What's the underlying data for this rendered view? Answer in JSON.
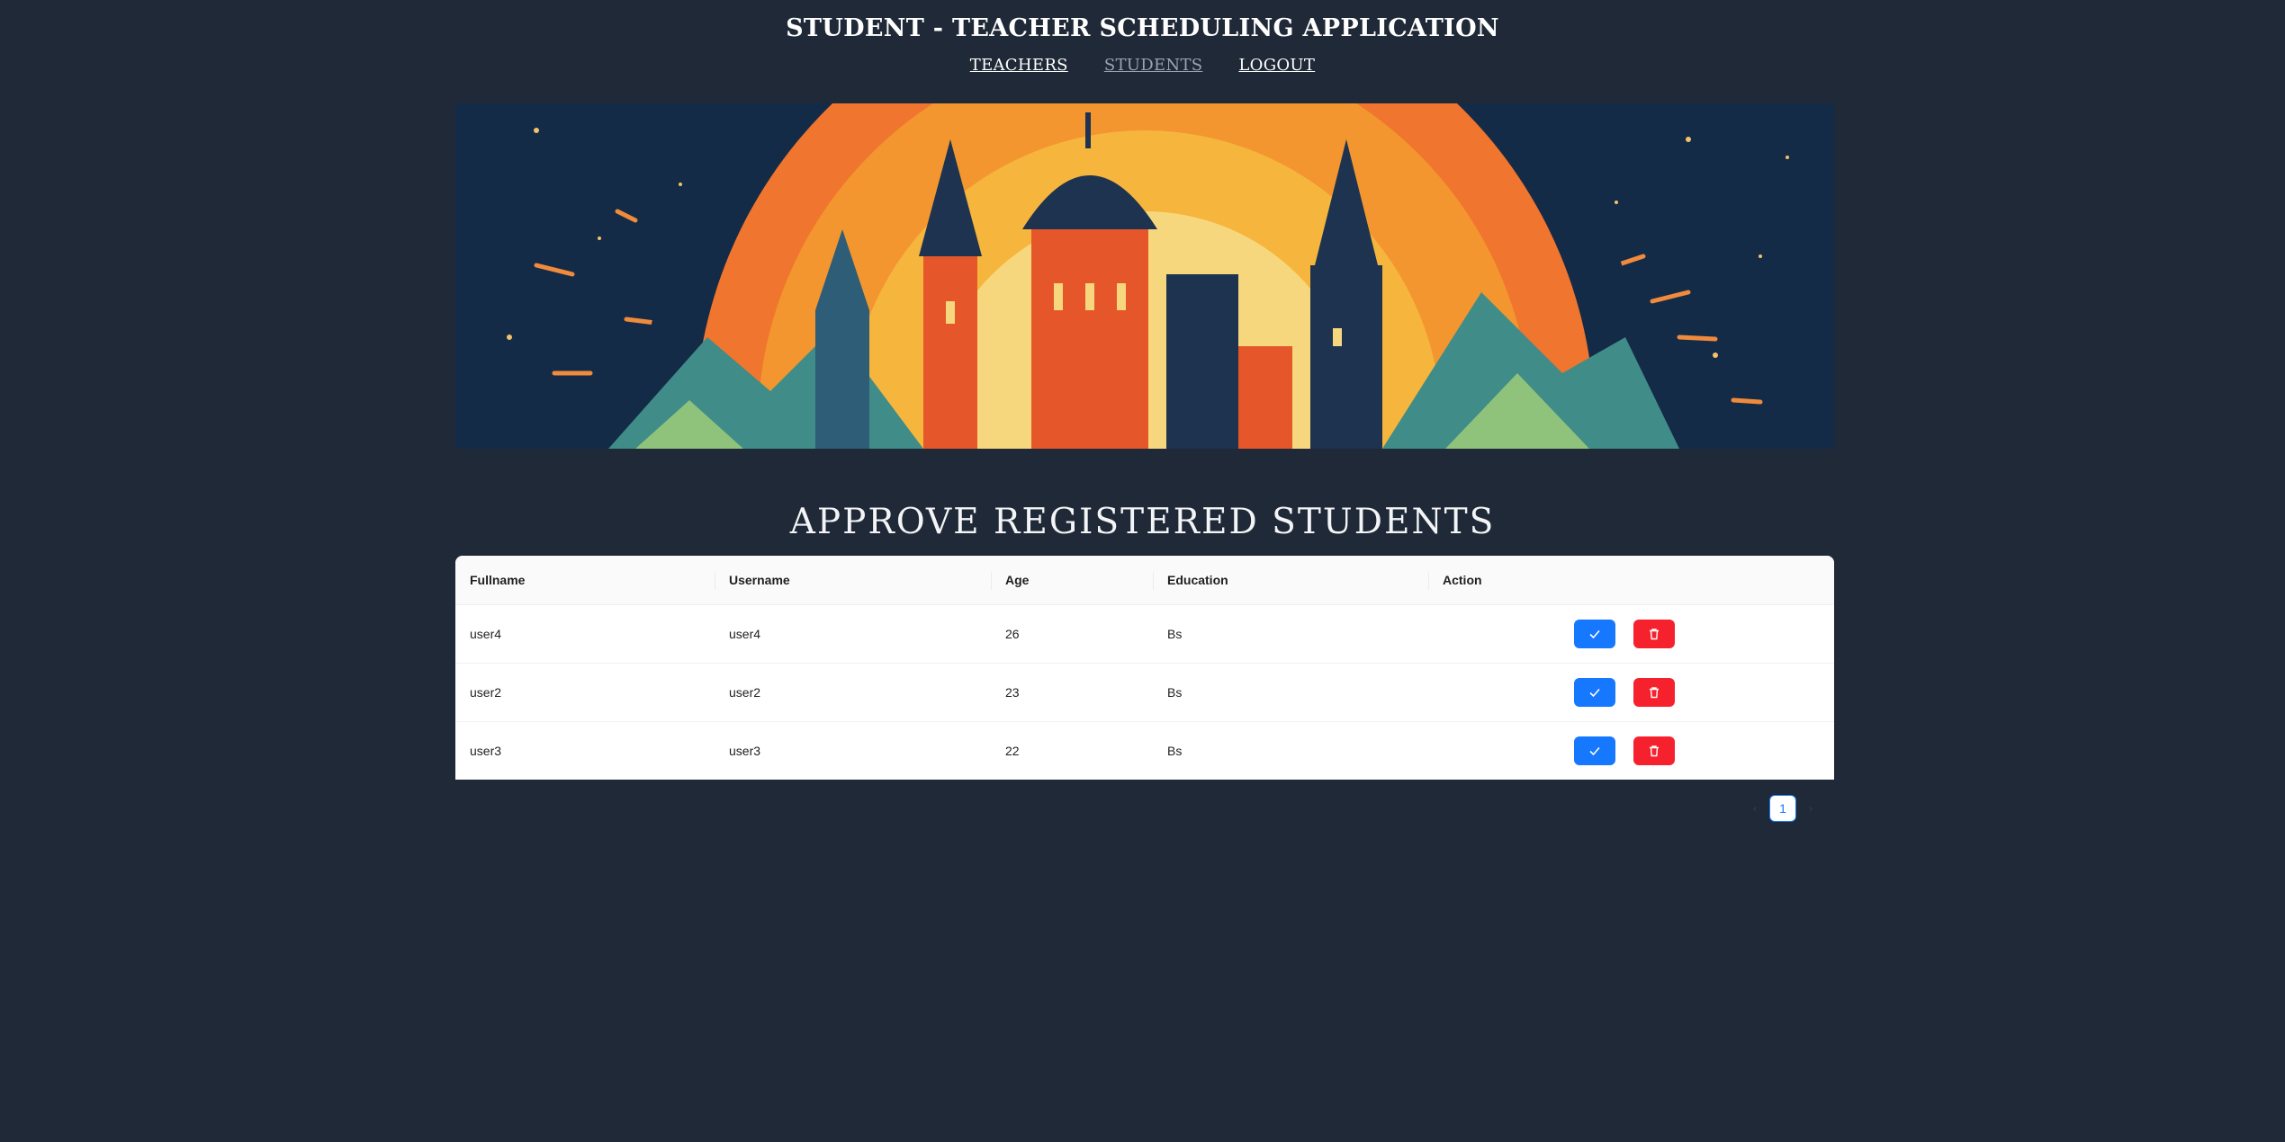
{
  "header": {
    "title": "STUDENT - TEACHER SCHEDULING APPLICATION",
    "nav": [
      {
        "label": "TEACHERS"
      },
      {
        "label": "STUDENTS"
      },
      {
        "label": "LOGOUT"
      }
    ]
  },
  "section_title": "APPROVE REGISTERED STUDENTS",
  "table": {
    "columns": [
      "Fullname",
      "Username",
      "Age",
      "Education",
      "Action"
    ],
    "rows": [
      {
        "fullname": "user4",
        "username": "user4",
        "age": "26",
        "education": "Bs"
      },
      {
        "fullname": "user2",
        "username": "user2",
        "age": "23",
        "education": "Bs"
      },
      {
        "fullname": "user3",
        "username": "user3",
        "age": "22",
        "education": "Bs"
      }
    ],
    "action_icons": {
      "approve": "check-icon",
      "delete": "trash-icon"
    }
  },
  "pagination": {
    "current": "1",
    "prev_icon": "chevron-left-icon",
    "next_icon": "chevron-right-icon"
  },
  "colors": {
    "background": "#1f2937",
    "approve": "#1677ff",
    "delete": "#f5222d"
  }
}
